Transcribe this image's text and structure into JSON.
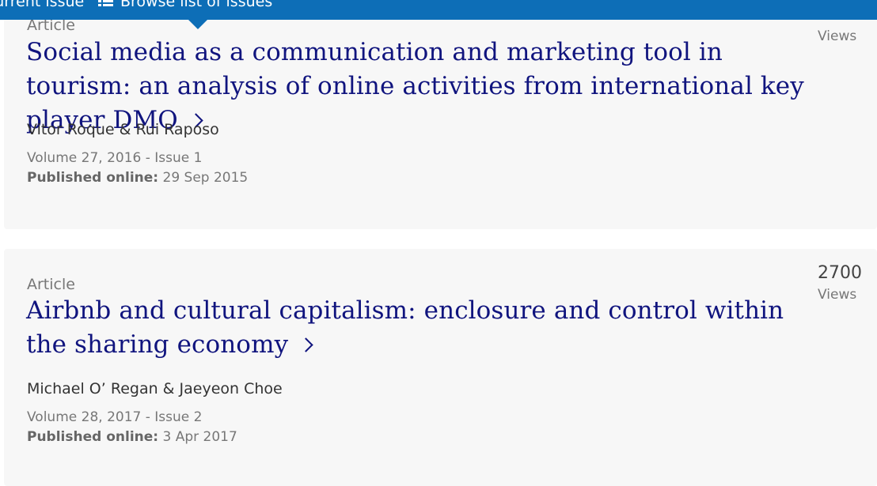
{
  "topbar": {
    "current_issue_label": "Current issue",
    "browse_label": "Browse list of issues",
    "color": "#0d6eb7"
  },
  "articles": [
    {
      "type": "Article",
      "title": "Social media as a communication and marketing tool in tourism: an analysis of online activities from international key player DMO",
      "authors": "Vitor Roque & Rui Raposo",
      "volume": "Volume 27, 2016 - Issue 1",
      "published_label": "Published online:",
      "published_date": "29 Sep 2015",
      "views_label": "Views"
    },
    {
      "type": "Article",
      "title": "Airbnb and cultural capitalism: enclosure and control within the sharing economy",
      "authors": "Michael O’ Regan & Jaeyeon Choe",
      "volume": "Volume 28, 2017 - Issue 2",
      "published_label": "Published online:",
      "published_date": "3 Apr 2017",
      "views_count": "2700",
      "views_label": "Views"
    }
  ],
  "colors": {
    "title_link": "#10147e",
    "card_background": "#f7f7f7",
    "meta_text": "#777777"
  }
}
